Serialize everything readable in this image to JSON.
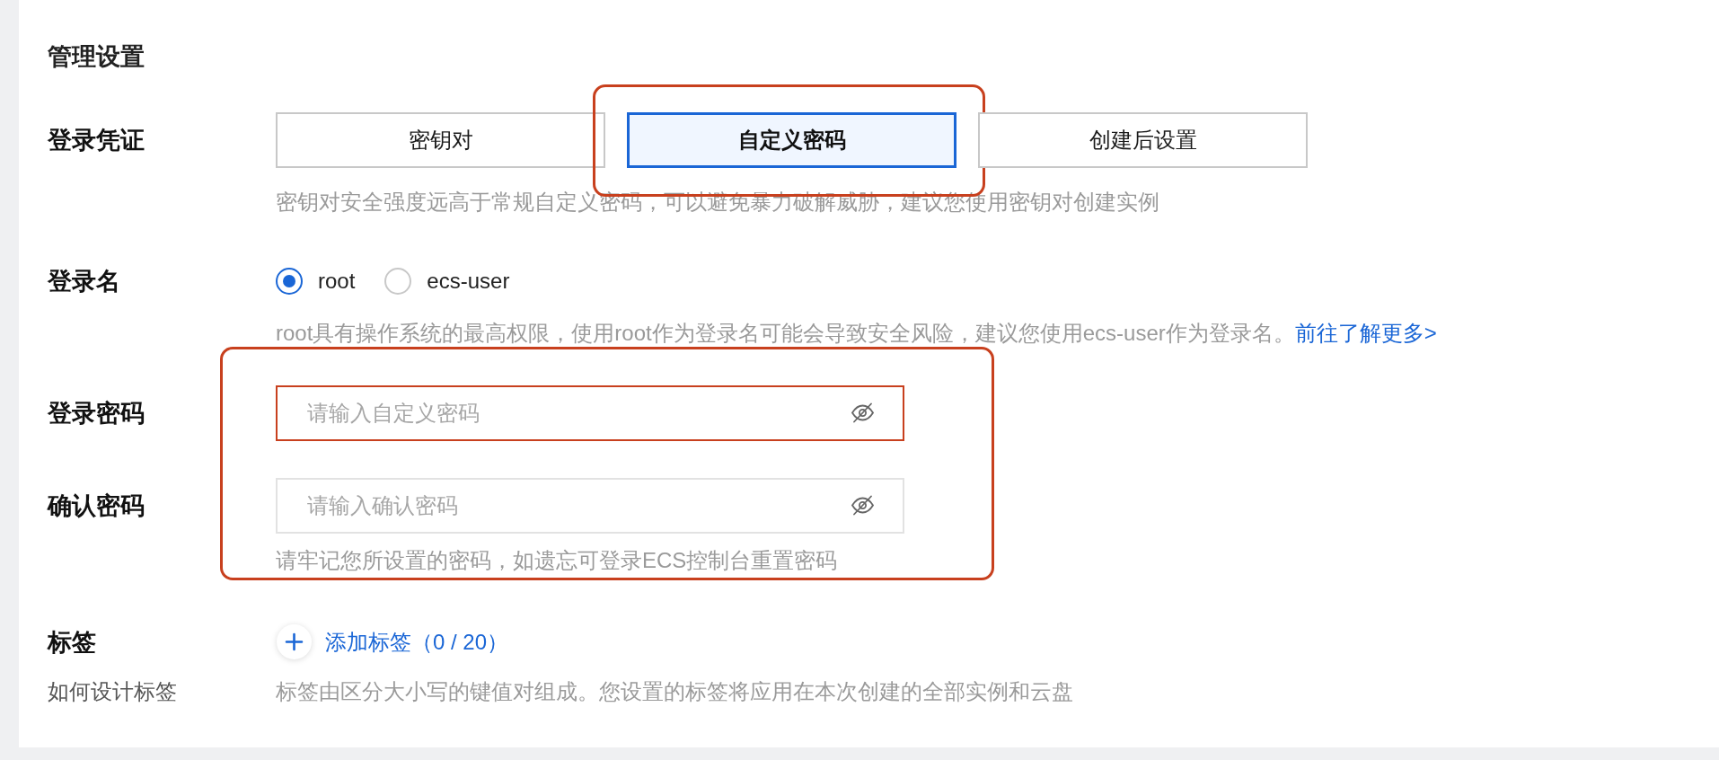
{
  "section_title": "管理设置",
  "login_credential": {
    "label": "登录凭证",
    "options": [
      {
        "label": "密钥对",
        "selected": false,
        "highlighted": false
      },
      {
        "label": "自定义密码",
        "selected": true,
        "highlighted": true
      },
      {
        "label": "创建后设置",
        "selected": false,
        "highlighted": false
      }
    ],
    "hint": "密钥对安全强度远高于常规自定义密码，可以避免暴力破解威胁，建议您使用密钥对创建实例"
  },
  "login_name": {
    "label": "登录名",
    "options": [
      {
        "label": "root",
        "selected": true
      },
      {
        "label": "ecs-user",
        "selected": false
      }
    ],
    "hint": "root具有操作系统的最高权限，使用root作为登录名可能会导致安全风险，建议您使用ecs-user作为登录名。",
    "link": "前往了解更多>"
  },
  "password_group": {
    "highlighted": true,
    "fields": [
      {
        "label": "登录密码",
        "placeholder": "请输入自定义密码",
        "highlighted": true
      },
      {
        "label": "确认密码",
        "placeholder": "请输入确认密码",
        "highlighted": false
      }
    ],
    "hint": "请牢记您所设置的密码，如遗忘可登录ECS控制台重置密码"
  },
  "tags": {
    "label": "标签",
    "add_button": "添加标签（0 / 20）",
    "sub_label": "如何设计标签",
    "hint": "标签由区分大小写的键值对组成。您设置的标签将应用在本次创建的全部实例和云盘"
  }
}
